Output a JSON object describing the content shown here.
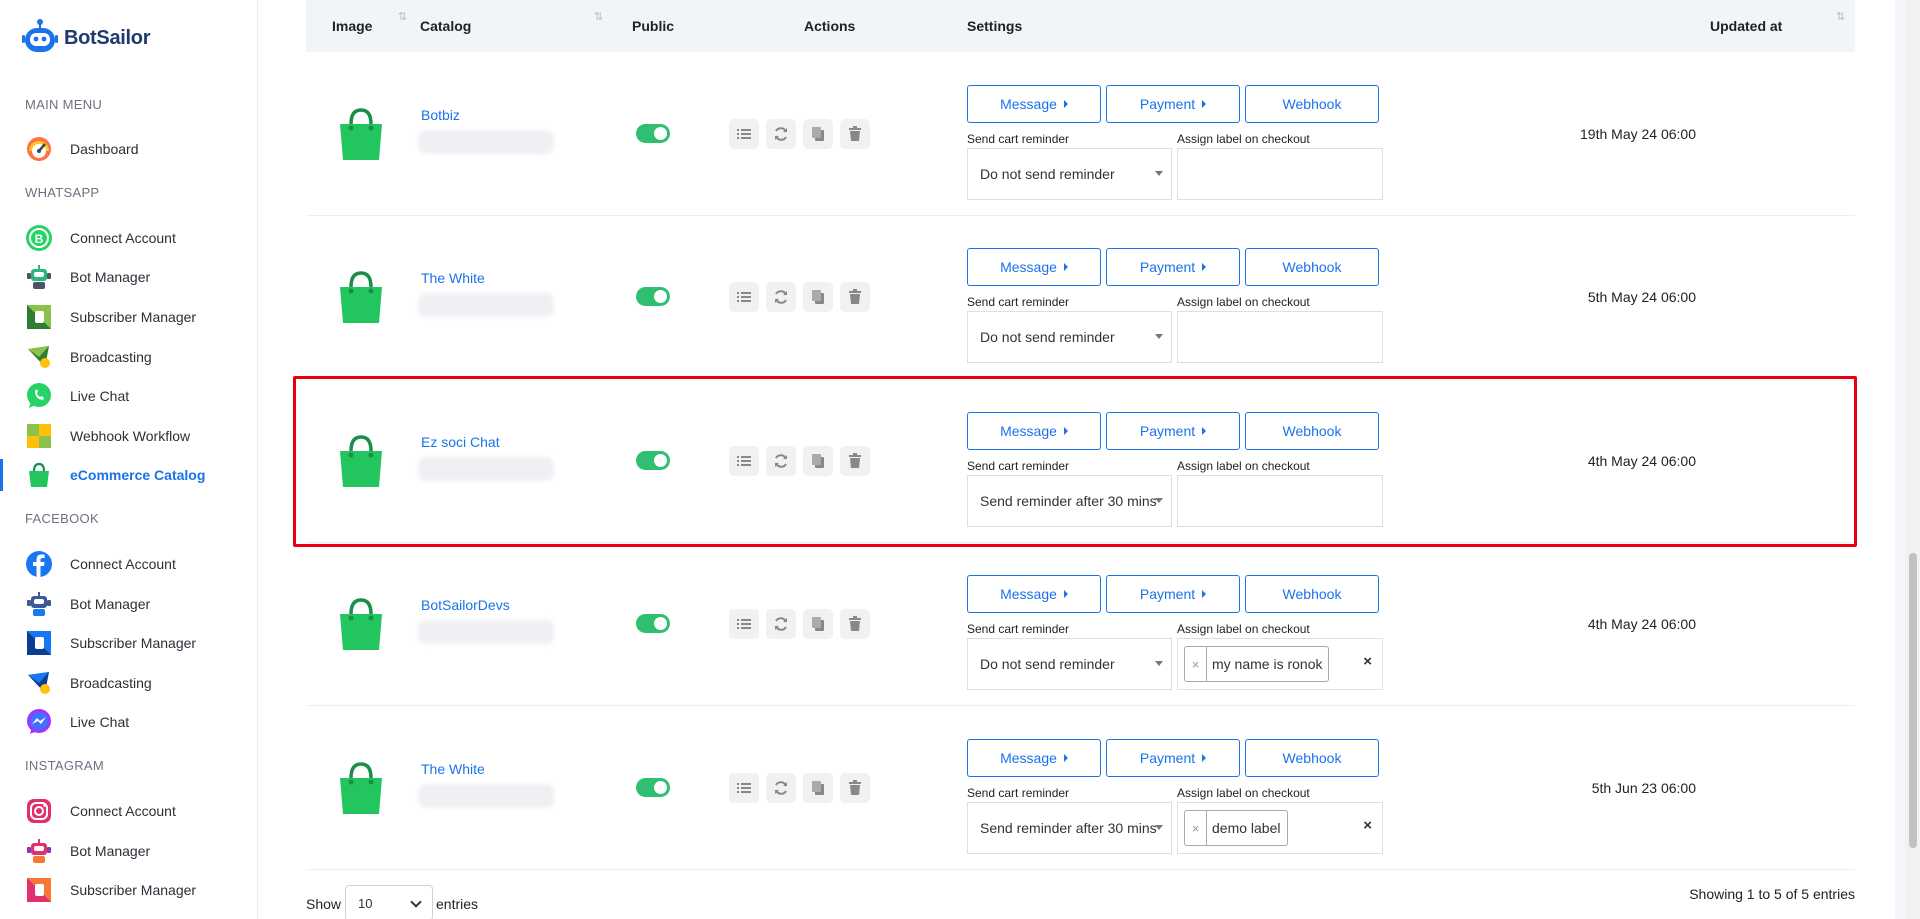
{
  "brand": {
    "name": "BotSailor"
  },
  "sidebar": {
    "sections": [
      {
        "title": "MAIN MENU",
        "items": [
          {
            "label": "Dashboard",
            "icon": "dashboard-gauge-icon"
          }
        ]
      },
      {
        "title": "WHATSAPP",
        "items": [
          {
            "label": "Connect Account",
            "icon": "whatsapp-business-icon"
          },
          {
            "label": "Bot Manager",
            "icon": "robot-icon"
          },
          {
            "label": "Subscriber Manager",
            "icon": "subscriber-icon"
          },
          {
            "label": "Broadcasting",
            "icon": "broadcast-icon"
          },
          {
            "label": "Live Chat",
            "icon": "whatsapp-icon"
          },
          {
            "label": "Webhook Workflow",
            "icon": "webhook-icon"
          },
          {
            "label": "eCommerce Catalog",
            "icon": "shopping-bag-icon",
            "active": true
          }
        ]
      },
      {
        "title": "FACEBOOK",
        "items": [
          {
            "label": "Connect Account",
            "icon": "facebook-icon"
          },
          {
            "label": "Bot Manager",
            "icon": "robot-icon"
          },
          {
            "label": "Subscriber Manager",
            "icon": "subscriber-icon"
          },
          {
            "label": "Broadcasting",
            "icon": "broadcast-icon"
          },
          {
            "label": "Live Chat",
            "icon": "messenger-icon"
          }
        ]
      },
      {
        "title": "INSTAGRAM",
        "items": [
          {
            "label": "Connect Account",
            "icon": "instagram-icon"
          },
          {
            "label": "Bot Manager",
            "icon": "robot-icon"
          },
          {
            "label": "Subscriber Manager",
            "icon": "subscriber-icon"
          }
        ]
      }
    ]
  },
  "table": {
    "columns": {
      "image": "Image",
      "catalog": "Catalog",
      "public": "Public",
      "actions": "Actions",
      "settings": "Settings",
      "updated": "Updated at"
    },
    "settings_labels": {
      "message": "Message",
      "payment": "Payment",
      "webhook": "Webhook",
      "cart_reminder": "Send cart reminder",
      "assign_label": "Assign label on checkout"
    },
    "rows": [
      {
        "catalog": "Botbiz",
        "public": true,
        "reminder": "Do not send reminder",
        "label": "",
        "updated": "19th May 24 06:00"
      },
      {
        "catalog": "The White",
        "public": true,
        "reminder": "Do not send reminder",
        "label": "",
        "updated": "5th May 24 06:00"
      },
      {
        "catalog": "Ez soci Chat",
        "public": true,
        "reminder": "Send reminder after 30 mins",
        "label": "",
        "updated": "4th May 24 06:00",
        "highlighted": true
      },
      {
        "catalog": "BotSailorDevs",
        "public": true,
        "reminder": "Do not send reminder",
        "label": "my name is ronok",
        "updated": "4th May 24 06:00"
      },
      {
        "catalog": "The White",
        "public": true,
        "reminder": "Send reminder after 30 mins",
        "label": "demo label",
        "updated": "5th Jun 23 06:00"
      }
    ]
  },
  "footer": {
    "show": "Show",
    "page_size": "10",
    "entries": "entries",
    "info": "Showing 1 to 5 of 5 entries"
  },
  "colors": {
    "accent": "#1a73e8",
    "toggle_on": "#2fbf71",
    "bag_green": "#22c55e",
    "highlight": "#e60012"
  }
}
